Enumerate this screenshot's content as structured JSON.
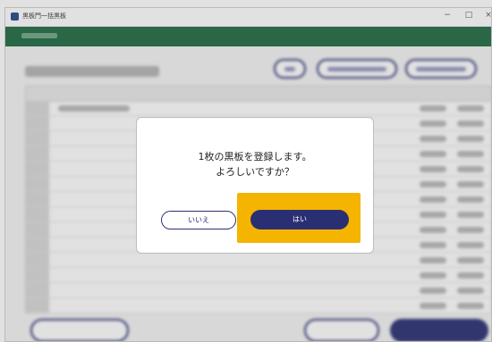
{
  "window": {
    "title": "黒板門一括黒板",
    "controls": {
      "minimize": "−",
      "maximize": "□",
      "close": "×"
    }
  },
  "dialog": {
    "line1": "1枚の黒板を登録します。",
    "line2": "よろしいですか？",
    "no_label": "いいえ",
    "yes_label": "はい"
  },
  "colors": {
    "header_green": "#1f6b43",
    "primary_navy": "#2a2f73",
    "highlight_yellow": "#f4b400"
  }
}
